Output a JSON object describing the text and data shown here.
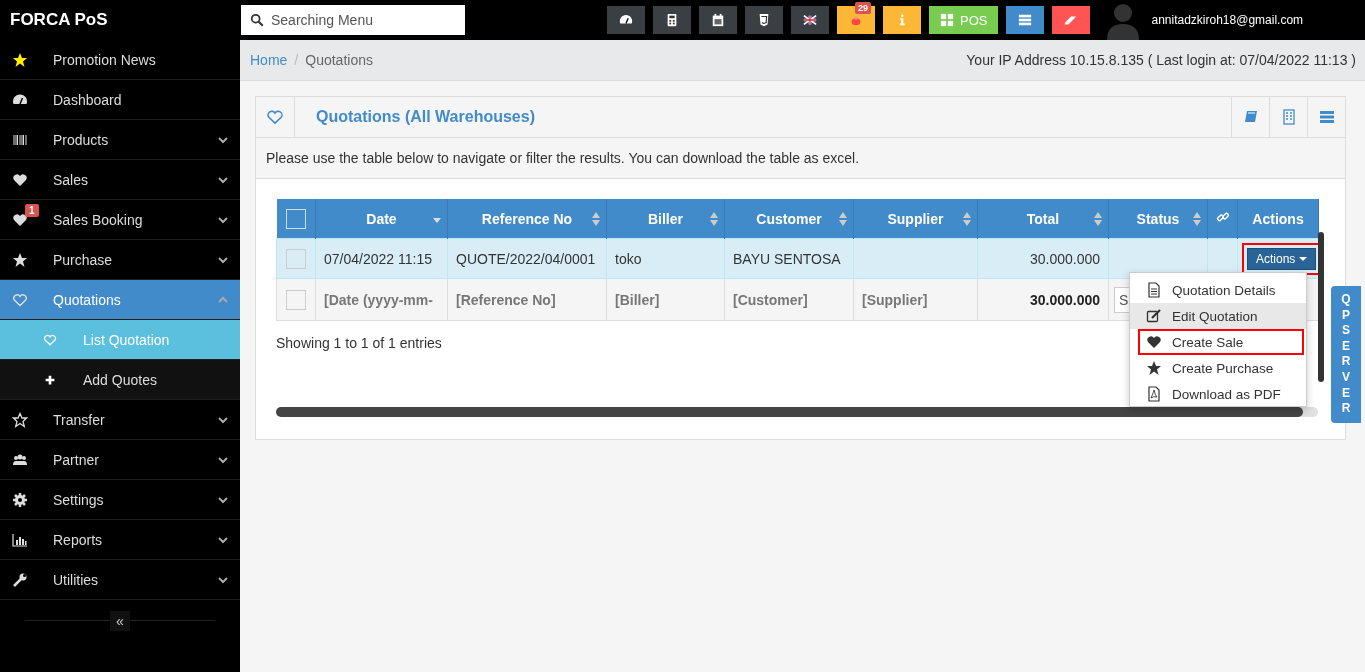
{
  "brand": "FORCA PoS",
  "search": {
    "placeholder": "Searching Menu"
  },
  "toolbar": [
    {
      "kind": "gauge",
      "color": "#3a3f44"
    },
    {
      "kind": "calculator",
      "color": "#3a3f44"
    },
    {
      "kind": "calendar",
      "color": "#3a3f44"
    },
    {
      "kind": "css",
      "color": "#3a3f44"
    },
    {
      "kind": "flag",
      "color": "#3a3f44"
    },
    {
      "kind": "alert",
      "color": "#fbb735",
      "badge": "29"
    },
    {
      "kind": "info",
      "color": "#fbb735"
    },
    {
      "kind": "grid",
      "color": "#78cd51",
      "label": "POS"
    },
    {
      "kind": "list",
      "color": "#428bca"
    },
    {
      "kind": "eraser",
      "color": "#ff5454"
    }
  ],
  "user": {
    "email": "annitadzkiroh18@gmail.com"
  },
  "sidebar": {
    "items": [
      {
        "label": "Promotion News",
        "kind": "promo-star",
        "has_submenu": false,
        "selected": false
      },
      {
        "label": "Dashboard",
        "kind": "gauge",
        "has_submenu": false,
        "selected": false
      },
      {
        "label": "Products",
        "kind": "barcode",
        "has_submenu": true,
        "expanded": false,
        "selected": false
      },
      {
        "label": "Sales",
        "kind": "heart",
        "has_submenu": true,
        "expanded": false,
        "selected": false
      },
      {
        "label": "Sales Booking",
        "kind": "heart",
        "has_submenu": true,
        "expanded": false,
        "selected": false,
        "badge": "1"
      },
      {
        "label": "Purchase",
        "kind": "star",
        "has_submenu": true,
        "expanded": false,
        "selected": false
      },
      {
        "label": "Quotations",
        "kind": "heart-outline",
        "has_submenu": true,
        "expanded": true,
        "selected": true,
        "children": [
          {
            "label": "List Quotation",
            "kind": "heart-outline",
            "selected": true
          },
          {
            "label": "Add Quotes",
            "kind": "plus",
            "selected": false
          }
        ]
      },
      {
        "label": "Transfer",
        "kind": "star-outline",
        "has_submenu": true,
        "expanded": false,
        "selected": false
      },
      {
        "label": "Partner",
        "kind": "users",
        "has_submenu": true,
        "expanded": false,
        "selected": false
      },
      {
        "label": "Settings",
        "kind": "gear",
        "has_submenu": true,
        "expanded": false,
        "selected": false
      },
      {
        "label": "Reports",
        "kind": "chart",
        "has_submenu": true,
        "expanded": false,
        "selected": false
      },
      {
        "label": "Utilities",
        "kind": "wrench",
        "has_submenu": true,
        "expanded": false,
        "selected": false
      }
    ],
    "collapse": "«"
  },
  "breadcrumb": {
    "items": [
      "Home",
      "Quotations"
    ],
    "separator": "/"
  },
  "ip_info": "Your IP Address 10.15.8.135 ( Last login at: 07/04/2022 11:13 )",
  "panel": {
    "title": "Quotations (All Warehouses)",
    "description": "Please use the table below to navigate or filter the results. You can download the table as excel."
  },
  "table": {
    "select_all": {
      "checked": false
    },
    "columns": [
      {
        "label": "Date",
        "kind": "sorted"
      },
      {
        "label": "Reference No",
        "kind": "sortable"
      },
      {
        "label": "Biller",
        "kind": "sortable"
      },
      {
        "label": "Customer",
        "kind": "sortable"
      },
      {
        "label": "Supplier",
        "kind": "sortable"
      },
      {
        "label": "Total",
        "kind": "sortable"
      },
      {
        "label": "Status",
        "kind": "sortable"
      },
      {
        "kind": "link"
      },
      {
        "label": "Actions",
        "kind": "plain"
      }
    ],
    "rows": [
      {
        "checked": false,
        "highlighted": true,
        "cells": [
          "07/04/2022 11:15",
          "QUOTE/2022/04/0001",
          "toko",
          "BAYU SENTOSA",
          "",
          "30.000.000",
          "",
          ""
        ],
        "action": {
          "label": "Actions",
          "outlined": true
        }
      }
    ],
    "filter_row": {
      "checked": false,
      "cells": [
        {
          "kind": "filter",
          "text": "[Date (yyyy-mm-"
        },
        {
          "kind": "filter",
          "text": "[Reference No]"
        },
        {
          "kind": "filter",
          "text": "[Biller]"
        },
        {
          "kind": "filter",
          "text": "[Customer]"
        },
        {
          "kind": "filter",
          "text": "[Supplier]"
        },
        {
          "kind": "total",
          "text": "30.000.000"
        },
        {
          "kind": "field",
          "placeholder": "S"
        }
      ]
    },
    "info": "Showing 1 to 1 of 1 entries"
  },
  "actions_menu": [
    {
      "label": "Quotation Details",
      "kind": "document",
      "hovered": false,
      "outlined": false
    },
    {
      "label": "Edit Quotation",
      "kind": "edit",
      "hovered": true,
      "outlined": false
    },
    {
      "label": "Create Sale",
      "kind": "heart",
      "hovered": false,
      "outlined": true
    },
    {
      "label": "Create Purchase",
      "kind": "star",
      "hovered": false,
      "outlined": false
    },
    {
      "label": "Download as PDF",
      "kind": "pdf",
      "hovered": false,
      "outlined": false
    }
  ],
  "side_tab": "QP SERVER"
}
